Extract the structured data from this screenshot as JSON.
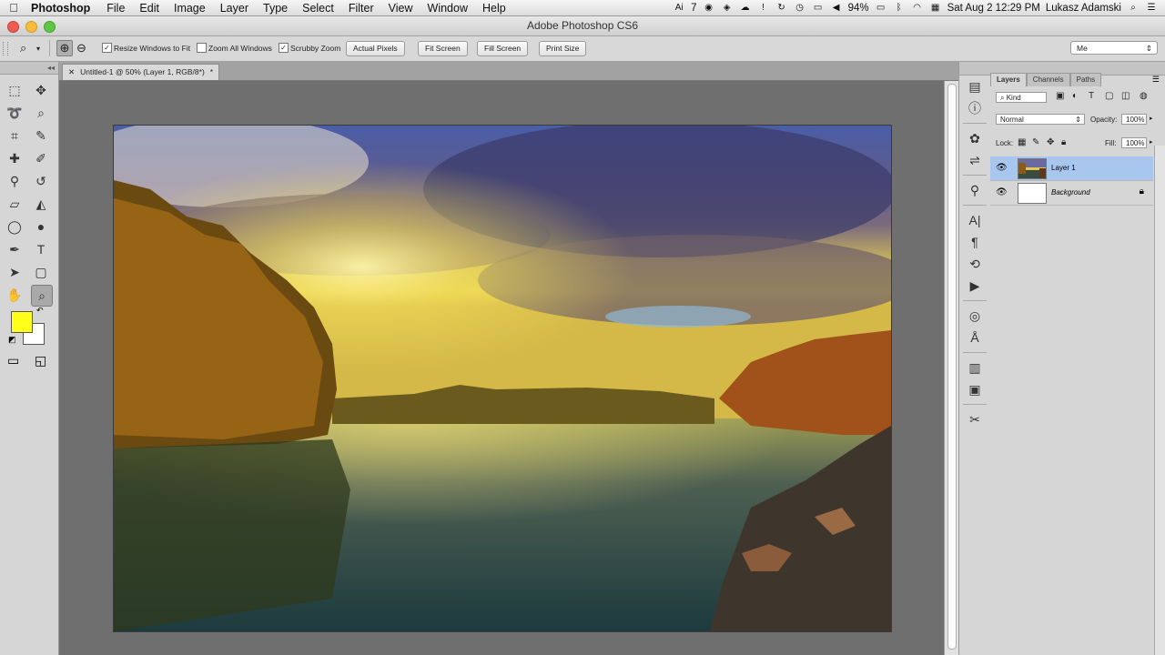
{
  "menubar": {
    "apple": "",
    "app": "Photoshop",
    "items": [
      "File",
      "Edit",
      "Image",
      "Layer",
      "Type",
      "Select",
      "Filter",
      "View",
      "Window",
      "Help"
    ],
    "ai_badge": "7",
    "battery": "94%",
    "clock": "Sat Aug 2  12:29 PM",
    "user": "Lukasz Adamski"
  },
  "window": {
    "title": "Adobe Photoshop CS6"
  },
  "options": {
    "resize_windows": "Resize Windows to Fit",
    "resize_windows_checked": true,
    "zoom_all": "Zoom All Windows",
    "zoom_all_checked": false,
    "scrubby": "Scrubby Zoom",
    "scrubby_checked": true,
    "actual_pixels": "Actual Pixels",
    "fit_screen": "Fit Screen",
    "fill_screen": "Fill Screen",
    "print_size": "Print Size",
    "workspace": "Me"
  },
  "document": {
    "tab_title": "Untitled-1 @ 50% (Layer 1, RGB/8*)",
    "tab_modified": "*",
    "close": "✕"
  },
  "colors": {
    "foreground": "#ffff1a",
    "background": "#ffffff",
    "selected_layer": "#a9c7ee"
  },
  "layers": {
    "tabs": [
      "Layers",
      "Channels",
      "Paths"
    ],
    "kind": "Kind",
    "blend_mode": "Normal",
    "opacity_label": "Opacity:",
    "opacity_value": "100%",
    "lock_label": "Lock:",
    "fill_label": "Fill:",
    "fill_value": "100%",
    "items": [
      {
        "name": "Layer 1",
        "selected": true
      },
      {
        "name": "Background",
        "selected": false,
        "locked": true
      }
    ]
  }
}
